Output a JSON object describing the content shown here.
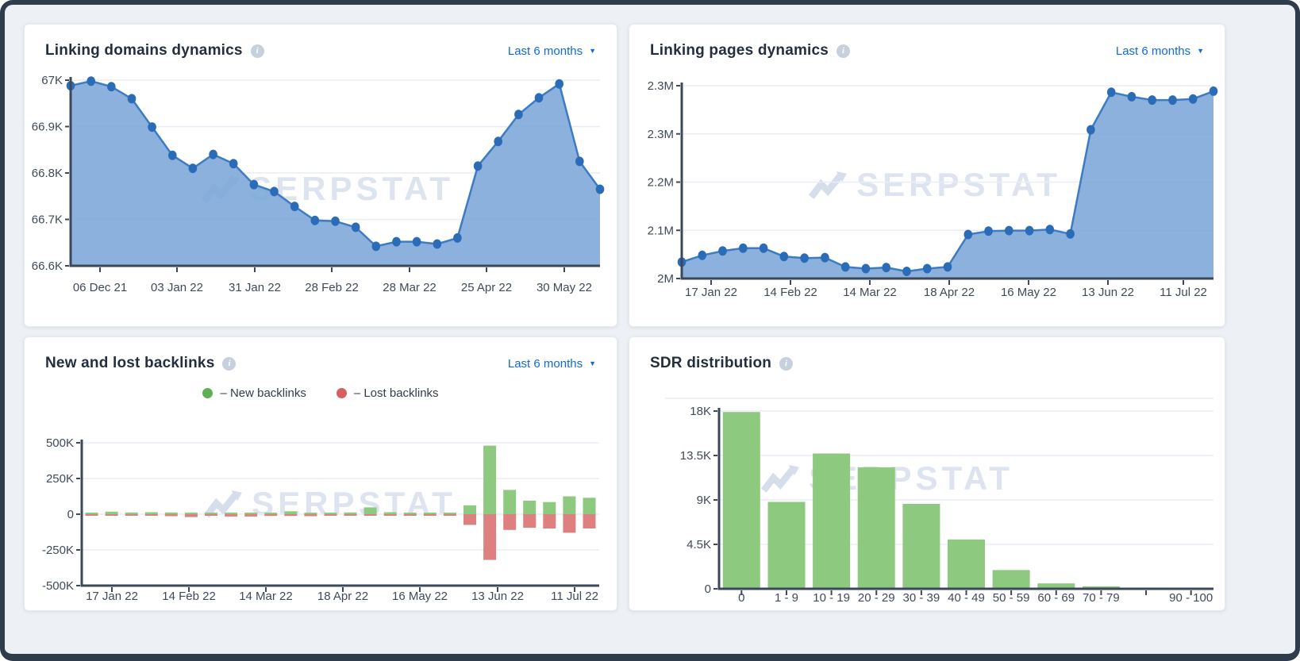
{
  "watermark": "SERPSTAT",
  "icons": {
    "info": "i",
    "caret": "▼"
  },
  "colors": {
    "accent_blue": "#1169dd",
    "area_fill": "#7ea9d8",
    "area_line": "#3d7bc4",
    "area_dot": "#2b6cb8",
    "new_bar": "#8dc97e",
    "lost_bar": "#df8080",
    "legend_new_dot": "#5cb150",
    "legend_lost_dot": "#d66060",
    "axis": "#3b4859",
    "grid": "#e9eef6"
  },
  "panels": [
    {
      "title": "Linking domains dynamics",
      "range_label": "Last 6 months"
    },
    {
      "title": "Linking pages dynamics",
      "range_label": "Last 6 months"
    },
    {
      "title": "New and lost backlinks",
      "range_label": "Last 6 months",
      "legend": [
        {
          "label": "– New backlinks"
        },
        {
          "label": "– Lost backlinks"
        }
      ]
    },
    {
      "title": "SDR distribution"
    }
  ],
  "chart_data": [
    {
      "type": "area",
      "title": "Linking domains dynamics",
      "x_ticks": [
        "06 Dec 21",
        "03 Jan 22",
        "31 Jan 22",
        "28 Feb 22",
        "28 Mar 22",
        "25 Apr 22",
        "30 May 22"
      ],
      "y_ticks": [
        "67K",
        "66.9K",
        "66.8K",
        "66.7K",
        "66.6K"
      ],
      "ylim": [
        66600,
        67000
      ],
      "grid": true,
      "legend_position": "none",
      "values": [
        66988,
        66998,
        66986,
        66960,
        66899,
        66838,
        66810,
        66840,
        66820,
        66775,
        66760,
        66728,
        66698,
        66696,
        66683,
        66642,
        66652,
        66652,
        66647,
        66660,
        66815,
        66868,
        66926,
        66962,
        66992,
        66825,
        66765
      ]
    },
    {
      "type": "area",
      "title": "Linking pages dynamics",
      "x_ticks": [
        "17 Jan 22",
        "14 Feb 22",
        "14 Mar 22",
        "18 Apr 22",
        "16 May 22",
        "13 Jun 22",
        "11 Jul 22"
      ],
      "y_ticks": [
        "2.3M",
        "2.3M",
        "2.2M",
        "2.1M",
        "2M"
      ],
      "ylim": [
        2000000,
        2350000
      ],
      "grid": true,
      "legend_position": "none",
      "values": [
        2030000,
        2042000,
        2050000,
        2055000,
        2055000,
        2040000,
        2037000,
        2038000,
        2021000,
        2018000,
        2020000,
        2013000,
        2018000,
        2021000,
        2080000,
        2086000,
        2087000,
        2087000,
        2089000,
        2081000,
        2270000,
        2338000,
        2330000,
        2324000,
        2324000,
        2326000,
        2340000
      ]
    },
    {
      "type": "bar",
      "title": "New and lost backlinks",
      "x_ticks": [
        "17 Jan 22",
        "14 Feb 22",
        "14 Mar 22",
        "18 Apr 22",
        "16 May 22",
        "13 Jun 22",
        "11 Jul 22"
      ],
      "y_ticks": [
        "500K",
        "250K",
        "0",
        "-250K",
        "-500K"
      ],
      "ylim": [
        -500000,
        500000
      ],
      "grid": true,
      "legend_position": "top",
      "series": [
        {
          "name": "New backlinks",
          "color": "#8dc97e",
          "values": [
            2000,
            18000,
            12000,
            14000,
            12000,
            6000,
            4000,
            8000,
            6000,
            8000,
            20000,
            5000,
            8000,
            12000,
            48000,
            14000,
            4000,
            2000,
            6000,
            62000,
            480000,
            170000,
            95000,
            85000,
            125000,
            115000
          ]
        },
        {
          "name": "Lost backlinks",
          "color": "#df8080",
          "values": [
            -5000,
            -8000,
            -8000,
            -10000,
            -14000,
            -20000,
            -10000,
            -16000,
            -16000,
            -12000,
            -12000,
            -14000,
            -6000,
            -10000,
            -8000,
            -6000,
            -4000,
            -6000,
            -8000,
            -75000,
            -320000,
            -110000,
            -95000,
            -100000,
            -130000,
            -100000
          ]
        }
      ]
    },
    {
      "type": "bar",
      "title": "SDR distribution",
      "categories": [
        "0",
        "1 - 9",
        "10 - 19",
        "20 - 29",
        "30 - 39",
        "40 - 49",
        "50 - 59",
        "60 - 69",
        "70 - 79",
        "",
        "90 - 100"
      ],
      "y_ticks": [
        "18K",
        "13.5K",
        "9K",
        "4.5K",
        "0"
      ],
      "ylim": [
        0,
        18000
      ],
      "grid": true,
      "legend_position": "none",
      "bar_color": "#8dc97e",
      "values": [
        17900,
        8800,
        13700,
        12300,
        8600,
        5000,
        1900,
        550,
        250,
        60,
        120
      ]
    }
  ]
}
